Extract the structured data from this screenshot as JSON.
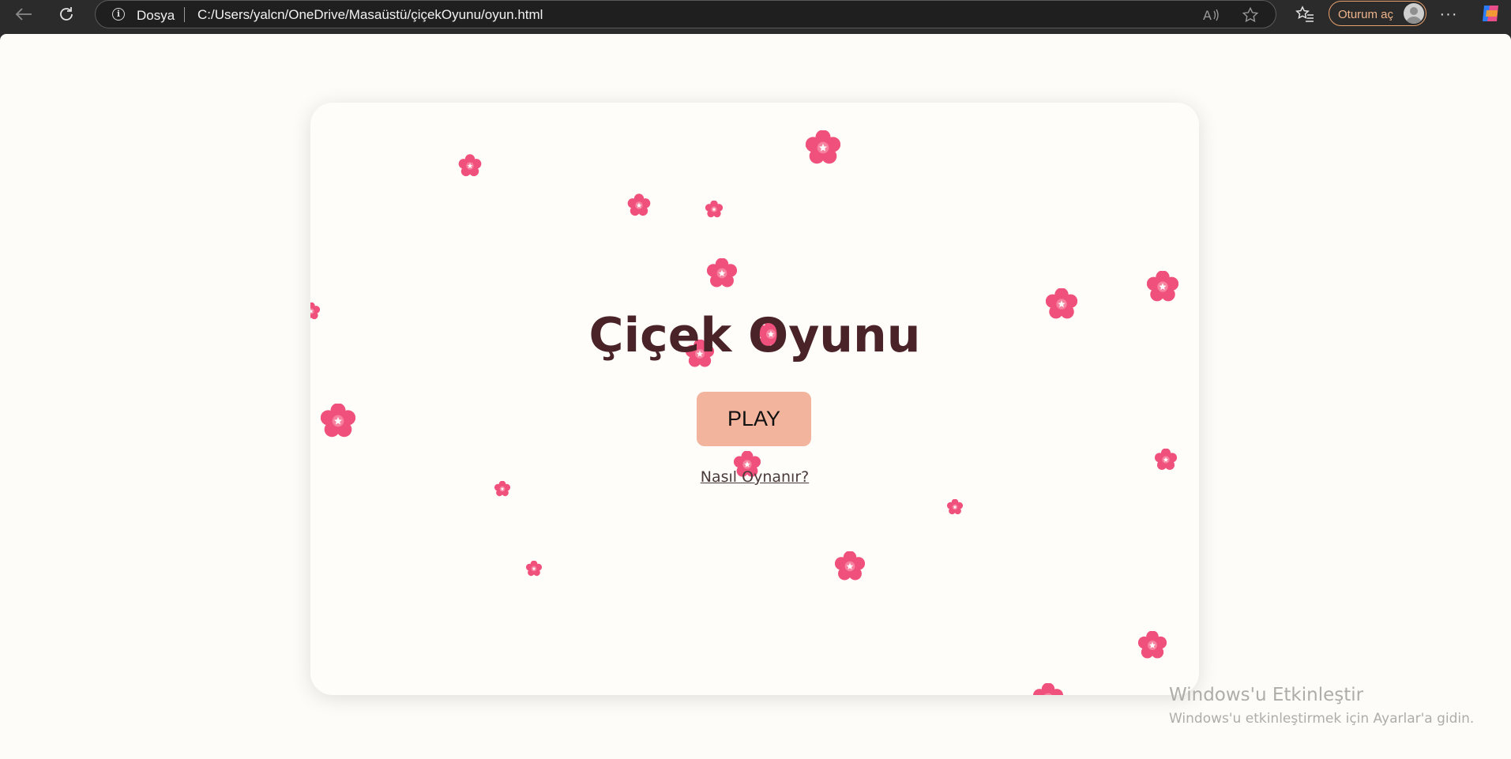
{
  "browser": {
    "site_label": "Dosya",
    "url": "C:/Users/yalcn/OneDrive/Masaüstü/çiçekOyunu/oyun.html",
    "signin_label": "Oturum aç",
    "more_label": "···"
  },
  "game": {
    "title": "Çiçek Oyunu",
    "play_label": "PLAY",
    "howto_label": "Nasıl Oynanır?"
  },
  "watermark": {
    "line1": "Windows'u Etkinleştir",
    "line2": "Windows'u etkinleştirmek için Ayarlar'a gidin."
  },
  "colors": {
    "title": "#4a2328",
    "play_button": "#f2b49d",
    "flower": "#f0517c",
    "card": "#fffdf9",
    "page": "#fdfcf8"
  }
}
